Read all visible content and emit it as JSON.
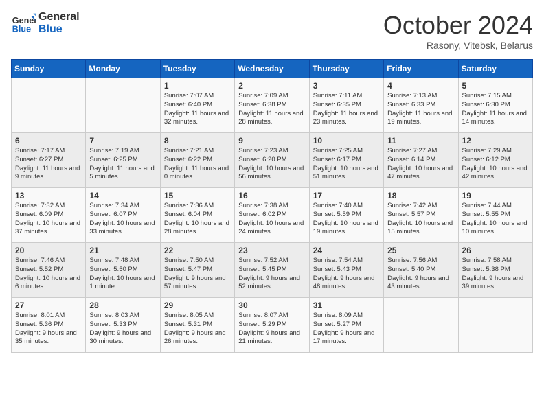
{
  "header": {
    "logo_line1": "General",
    "logo_line2": "Blue",
    "month": "October 2024",
    "location": "Rasony, Vitebsk, Belarus"
  },
  "weekdays": [
    "Sunday",
    "Monday",
    "Tuesday",
    "Wednesday",
    "Thursday",
    "Friday",
    "Saturday"
  ],
  "weeks": [
    [
      {
        "day": "",
        "info": ""
      },
      {
        "day": "",
        "info": ""
      },
      {
        "day": "1",
        "info": "Sunrise: 7:07 AM\nSunset: 6:40 PM\nDaylight: 11 hours and 32 minutes."
      },
      {
        "day": "2",
        "info": "Sunrise: 7:09 AM\nSunset: 6:38 PM\nDaylight: 11 hours and 28 minutes."
      },
      {
        "day": "3",
        "info": "Sunrise: 7:11 AM\nSunset: 6:35 PM\nDaylight: 11 hours and 23 minutes."
      },
      {
        "day": "4",
        "info": "Sunrise: 7:13 AM\nSunset: 6:33 PM\nDaylight: 11 hours and 19 minutes."
      },
      {
        "day": "5",
        "info": "Sunrise: 7:15 AM\nSunset: 6:30 PM\nDaylight: 11 hours and 14 minutes."
      }
    ],
    [
      {
        "day": "6",
        "info": "Sunrise: 7:17 AM\nSunset: 6:27 PM\nDaylight: 11 hours and 9 minutes."
      },
      {
        "day": "7",
        "info": "Sunrise: 7:19 AM\nSunset: 6:25 PM\nDaylight: 11 hours and 5 minutes."
      },
      {
        "day": "8",
        "info": "Sunrise: 7:21 AM\nSunset: 6:22 PM\nDaylight: 11 hours and 0 minutes."
      },
      {
        "day": "9",
        "info": "Sunrise: 7:23 AM\nSunset: 6:20 PM\nDaylight: 10 hours and 56 minutes."
      },
      {
        "day": "10",
        "info": "Sunrise: 7:25 AM\nSunset: 6:17 PM\nDaylight: 10 hours and 51 minutes."
      },
      {
        "day": "11",
        "info": "Sunrise: 7:27 AM\nSunset: 6:14 PM\nDaylight: 10 hours and 47 minutes."
      },
      {
        "day": "12",
        "info": "Sunrise: 7:29 AM\nSunset: 6:12 PM\nDaylight: 10 hours and 42 minutes."
      }
    ],
    [
      {
        "day": "13",
        "info": "Sunrise: 7:32 AM\nSunset: 6:09 PM\nDaylight: 10 hours and 37 minutes."
      },
      {
        "day": "14",
        "info": "Sunrise: 7:34 AM\nSunset: 6:07 PM\nDaylight: 10 hours and 33 minutes."
      },
      {
        "day": "15",
        "info": "Sunrise: 7:36 AM\nSunset: 6:04 PM\nDaylight: 10 hours and 28 minutes."
      },
      {
        "day": "16",
        "info": "Sunrise: 7:38 AM\nSunset: 6:02 PM\nDaylight: 10 hours and 24 minutes."
      },
      {
        "day": "17",
        "info": "Sunrise: 7:40 AM\nSunset: 5:59 PM\nDaylight: 10 hours and 19 minutes."
      },
      {
        "day": "18",
        "info": "Sunrise: 7:42 AM\nSunset: 5:57 PM\nDaylight: 10 hours and 15 minutes."
      },
      {
        "day": "19",
        "info": "Sunrise: 7:44 AM\nSunset: 5:55 PM\nDaylight: 10 hours and 10 minutes."
      }
    ],
    [
      {
        "day": "20",
        "info": "Sunrise: 7:46 AM\nSunset: 5:52 PM\nDaylight: 10 hours and 6 minutes."
      },
      {
        "day": "21",
        "info": "Sunrise: 7:48 AM\nSunset: 5:50 PM\nDaylight: 10 hours and 1 minute."
      },
      {
        "day": "22",
        "info": "Sunrise: 7:50 AM\nSunset: 5:47 PM\nDaylight: 9 hours and 57 minutes."
      },
      {
        "day": "23",
        "info": "Sunrise: 7:52 AM\nSunset: 5:45 PM\nDaylight: 9 hours and 52 minutes."
      },
      {
        "day": "24",
        "info": "Sunrise: 7:54 AM\nSunset: 5:43 PM\nDaylight: 9 hours and 48 minutes."
      },
      {
        "day": "25",
        "info": "Sunrise: 7:56 AM\nSunset: 5:40 PM\nDaylight: 9 hours and 43 minutes."
      },
      {
        "day": "26",
        "info": "Sunrise: 7:58 AM\nSunset: 5:38 PM\nDaylight: 9 hours and 39 minutes."
      }
    ],
    [
      {
        "day": "27",
        "info": "Sunrise: 8:01 AM\nSunset: 5:36 PM\nDaylight: 9 hours and 35 minutes."
      },
      {
        "day": "28",
        "info": "Sunrise: 8:03 AM\nSunset: 5:33 PM\nDaylight: 9 hours and 30 minutes."
      },
      {
        "day": "29",
        "info": "Sunrise: 8:05 AM\nSunset: 5:31 PM\nDaylight: 9 hours and 26 minutes."
      },
      {
        "day": "30",
        "info": "Sunrise: 8:07 AM\nSunset: 5:29 PM\nDaylight: 9 hours and 21 minutes."
      },
      {
        "day": "31",
        "info": "Sunrise: 8:09 AM\nSunset: 5:27 PM\nDaylight: 9 hours and 17 minutes."
      },
      {
        "day": "",
        "info": ""
      },
      {
        "day": "",
        "info": ""
      }
    ]
  ]
}
